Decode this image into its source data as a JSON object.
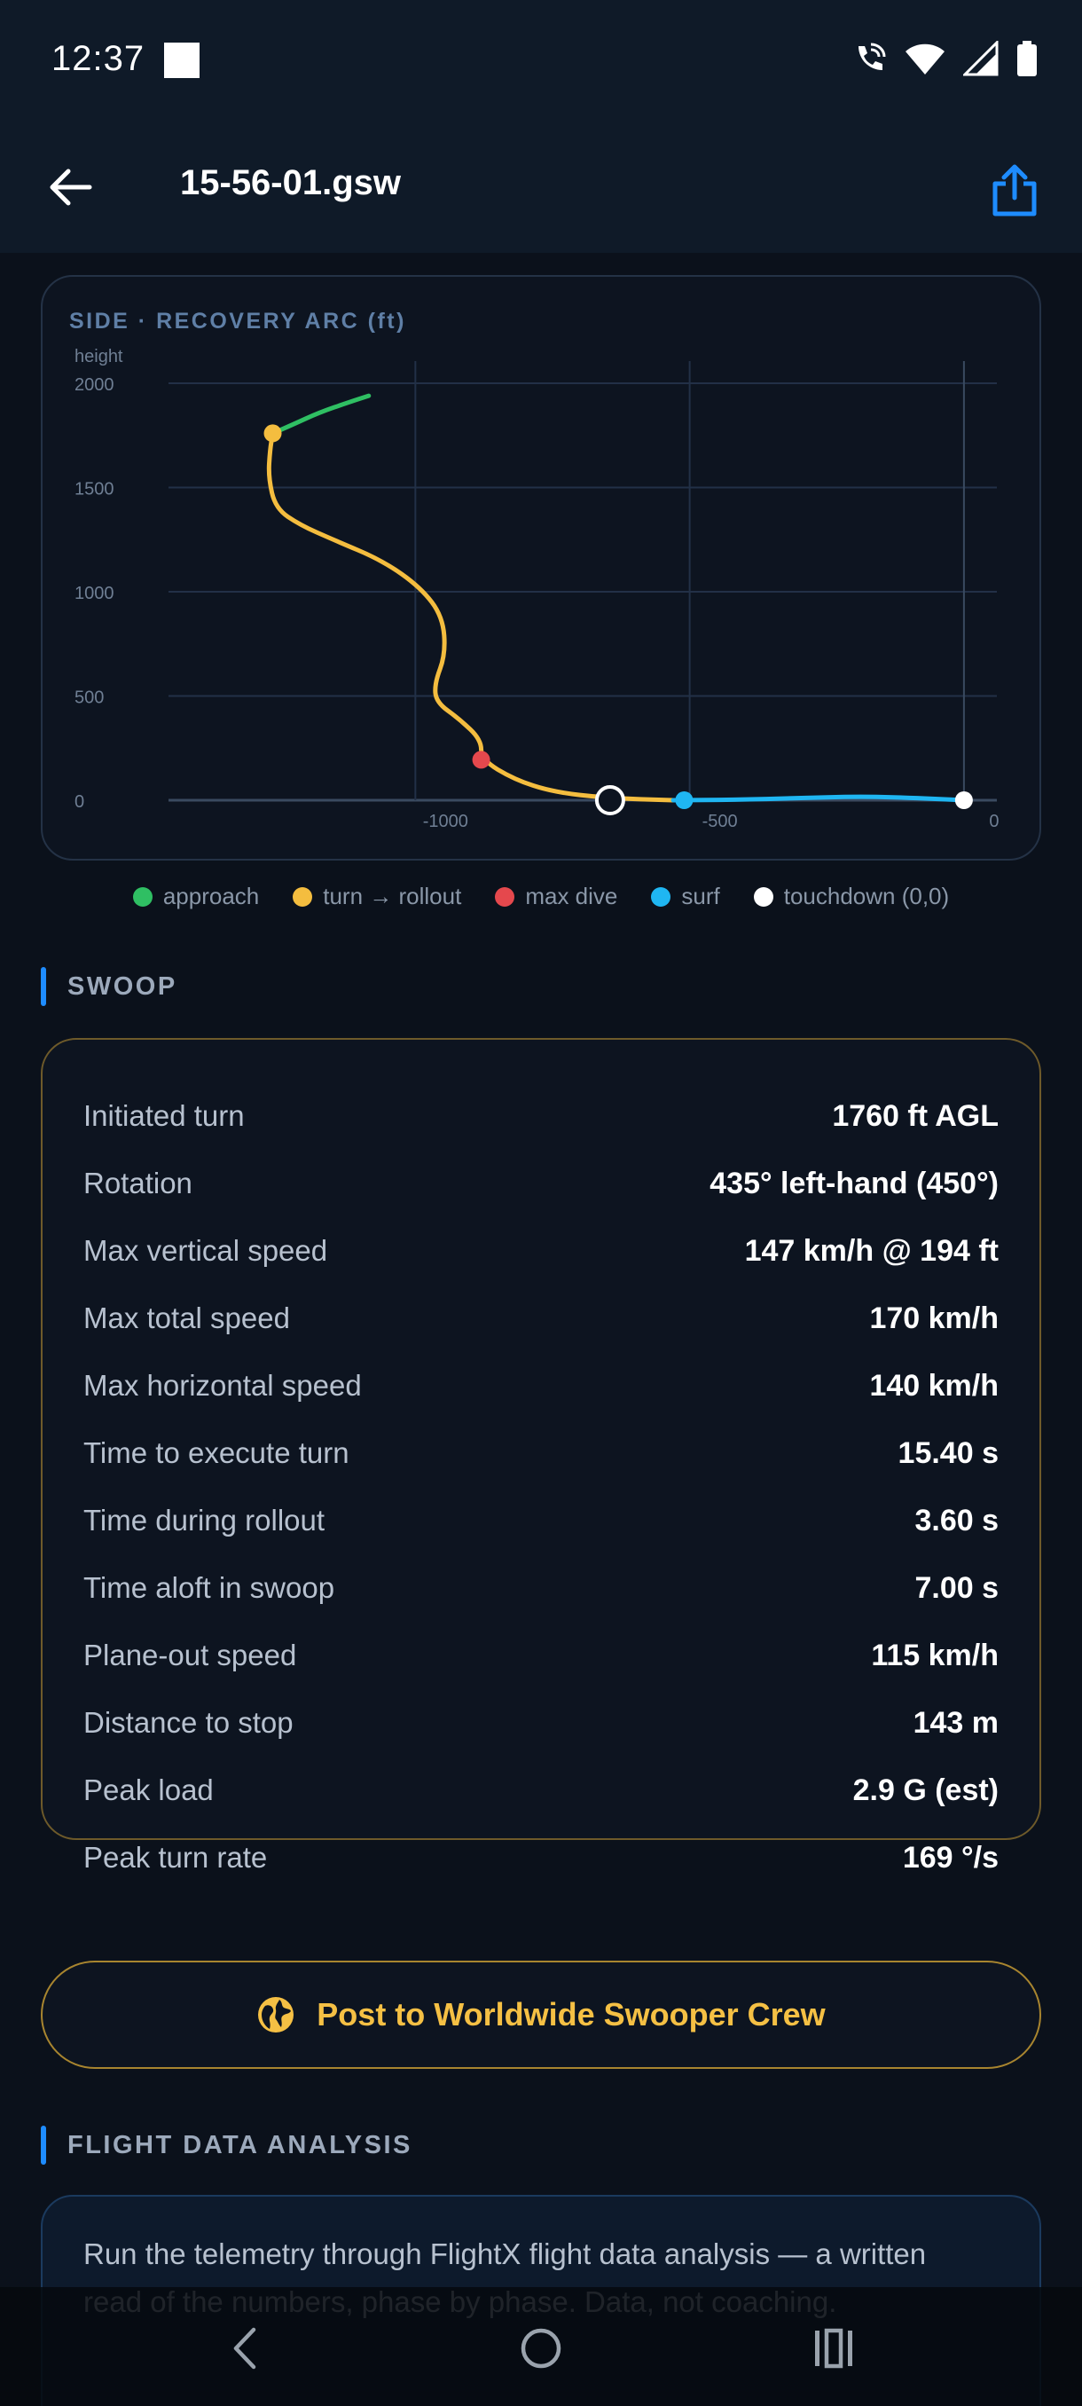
{
  "status_bar": {
    "time": "12:37",
    "icons": [
      "wifi-calling-icon",
      "wifi-icon",
      "signal-icon",
      "battery-icon"
    ]
  },
  "app_bar": {
    "title": "15-56-01.gsw",
    "back_icon": "arrow-left-icon",
    "share_icon": "share-icon"
  },
  "chart_data": {
    "type": "line",
    "title": "SIDE · RECOVERY ARC (ft)",
    "ylabel": "height",
    "xlabel": "",
    "xlim": [
      -1450,
      60
    ],
    "ylim": [
      0,
      2000
    ],
    "x_ticks": [
      -1000,
      -500,
      0
    ],
    "y_ticks": [
      0,
      500,
      1000,
      1500,
      2000
    ],
    "grid": true,
    "colors": {
      "approach": "#2fbf63",
      "turn_rollout": "#f4bd3f",
      "max_dive": "#e5484d",
      "surf": "#1fb6f2",
      "touchdown": "#ffffff"
    },
    "series": [
      {
        "name": "approach",
        "x": [
          -1260,
          -1225,
          -1175,
          -1120,
          -1085
        ],
        "y": [
          1760,
          1800,
          1860,
          1910,
          1940
        ]
      },
      {
        "name": "turn → rollout",
        "x": [
          -1260,
          -1265,
          -1268,
          -1255,
          -1210,
          -1150,
          -1060,
          -990,
          -950,
          -945,
          -965,
          -962,
          -920,
          -880,
          -880,
          -820,
          -750,
          -650,
          -530
        ],
        "y": [
          1760,
          1680,
          1550,
          1400,
          1320,
          1250,
          1150,
          1020,
          880,
          700,
          560,
          470,
          390,
          290,
          195,
          100,
          40,
          10,
          0
        ]
      },
      {
        "name": "surf",
        "x": [
          -530,
          -420,
          -300,
          -200,
          -120,
          -50,
          0
        ],
        "y": [
          0,
          2,
          10,
          18,
          14,
          6,
          0
        ]
      }
    ],
    "markers": [
      {
        "name": "turn start",
        "x": -1260,
        "y": 1760,
        "color": "#f4bd3f"
      },
      {
        "name": "max dive",
        "x": -880,
        "y": 194,
        "color": "#e5484d"
      },
      {
        "name": "rollout end",
        "x": -645,
        "y": 0,
        "color": "#ffffff",
        "style": "open"
      },
      {
        "name": "surf",
        "x": -510,
        "y": 0,
        "color": "#1fb6f2"
      },
      {
        "name": "touchdown",
        "x": 0,
        "y": 0,
        "color": "#ffffff"
      }
    ],
    "legend": [
      {
        "label": "approach",
        "color": "#2fbf63"
      },
      {
        "label": "turn → rollout",
        "color": "#f4bd3f"
      },
      {
        "label": "max dive",
        "color": "#e5484d"
      },
      {
        "label": "surf",
        "color": "#1fb6f2"
      },
      {
        "label": "touchdown (0,0)",
        "color": "#ffffff"
      }
    ],
    "legend_position": "bottom"
  },
  "sections": {
    "swoop": "SWOOP",
    "analysis": "FLIGHT DATA ANALYSIS"
  },
  "stats": [
    {
      "label": "Initiated turn",
      "value": "1760 ft AGL"
    },
    {
      "label": "Rotation",
      "value": "435° left-hand (450°)"
    },
    {
      "label": "Max vertical speed",
      "value": "147 km/h @ 194 ft"
    },
    {
      "label": "Max total speed",
      "value": "170 km/h"
    },
    {
      "label": "Max horizontal speed",
      "value": "140 km/h"
    },
    {
      "label": "Time to execute turn",
      "value": "15.40 s"
    },
    {
      "label": "Time during rollout",
      "value": "3.60 s"
    },
    {
      "label": "Time aloft in swoop",
      "value": "7.00 s"
    },
    {
      "label": "Plane-out speed",
      "value": "115 km/h"
    },
    {
      "label": "Distance to stop",
      "value": "143 m"
    },
    {
      "label": "Peak load",
      "value": "2.9 G (est)"
    },
    {
      "label": "Peak turn rate",
      "value": "169 °/s"
    }
  ],
  "post_button": {
    "label": "Post to Worldwide Swooper Crew",
    "icon": "globe-icon",
    "color": "#f5c044"
  },
  "analysis": {
    "text": "Run the telemetry through FlightX flight data analysis — a written read of the numbers, phase by phase. Data, not coaching."
  },
  "nav_bar": {
    "icons": [
      "back-nav-icon",
      "home-nav-icon",
      "recents-nav-icon"
    ]
  }
}
